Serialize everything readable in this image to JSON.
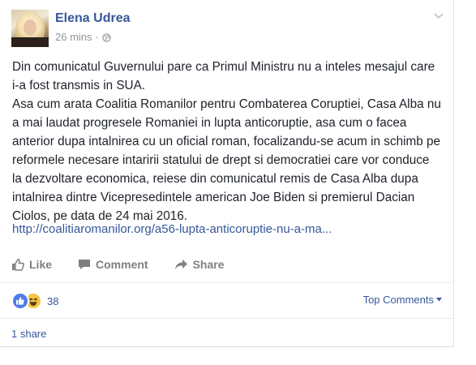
{
  "post": {
    "author": "Elena Udrea",
    "time": "26 mins",
    "separator": "·",
    "privacy_icon": "globe-icon",
    "paragraphs": [
      "Din comunicatul Guvernului pare ca Primul Ministru nu a inteles mesajul care i-a fost transmis in SUA.",
      "Asa cum arata Coalitia Romanilor pentru Combaterea Coruptiei, Casa Alba nu a mai laudat progresele Romaniei in lupta anticoruptie, asa cum o facea anterior dupa intalnirea cu un oficial roman, focalizandu-se acum in schimb pe reformele necesare intaririi statului de drept si democratiei care vor conduce la dezvoltare economica, reiese din comunicatul remis de Casa Alba dupa intalnirea dintre Vicepresedintele american Joe Biden si premierul Dacian Ciolos, pe data de 24 mai 2016."
    ],
    "link": "http://coalitiaromanilor.org/a56-lupta-anticoruptie-nu-a-ma..."
  },
  "actions": {
    "like": "Like",
    "comment": "Comment",
    "share": "Share"
  },
  "reactions": {
    "types": [
      "like-reaction-icon",
      "haha-reaction-icon"
    ],
    "count": "38"
  },
  "comments": {
    "sort_label": "Top Comments"
  },
  "shares": {
    "label": "1 share"
  },
  "colors": {
    "link": "#365899",
    "muted": "#90949c",
    "action": "#7f7f7f",
    "like_blue": "#4f7ce8",
    "haha_yellow": "#f7c443"
  }
}
